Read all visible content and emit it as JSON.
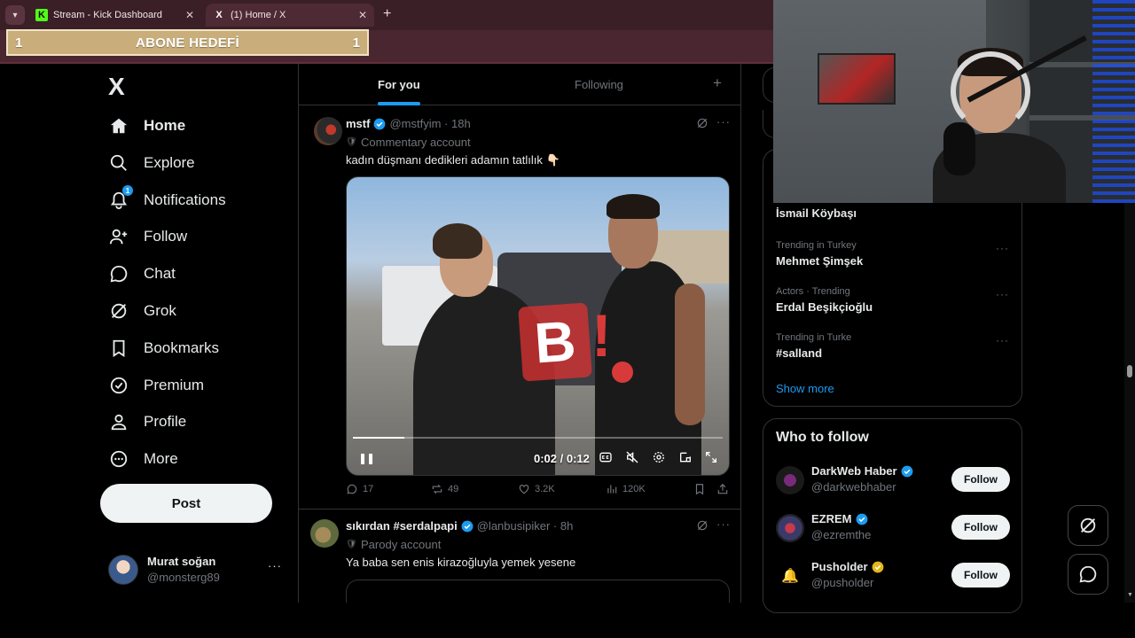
{
  "browser": {
    "tabs": [
      {
        "title": "Stream - Kick Dashboard",
        "favicon": "K",
        "active": false
      },
      {
        "title": "(1) Home / X",
        "favicon": "X",
        "active": true
      }
    ],
    "new_tab_label": "+"
  },
  "overlay": {
    "goal_left": "1",
    "goal_title": "ABONE HEDEFİ",
    "goal_right": "1"
  },
  "nav": {
    "logo": "X",
    "items": [
      {
        "label": "Home",
        "icon": "home-icon"
      },
      {
        "label": "Explore",
        "icon": "search-icon"
      },
      {
        "label": "Notifications",
        "icon": "bell-icon",
        "badge": "1"
      },
      {
        "label": "Follow",
        "icon": "person-add-icon"
      },
      {
        "label": "Chat",
        "icon": "chat-icon"
      },
      {
        "label": "Grok",
        "icon": "grok-icon"
      },
      {
        "label": "Bookmarks",
        "icon": "bookmark-icon"
      },
      {
        "label": "Premium",
        "icon": "premium-icon"
      },
      {
        "label": "Profile",
        "icon": "profile-icon"
      },
      {
        "label": "More",
        "icon": "more-circle-icon"
      }
    ],
    "post_label": "Post",
    "account": {
      "name": "Murat soğan",
      "handle": "@monsterg89",
      "more": "···"
    }
  },
  "feed": {
    "tabs": {
      "for_you": "For you",
      "following": "Following",
      "add": "+"
    },
    "tweets": [
      {
        "name": "mstf",
        "handle": "@mstfyim",
        "time": "18h",
        "account_tag": "Commentary account",
        "text": "kadın düşmanı dedikleri adamın tatlılık 👇🏻",
        "video": {
          "time": "0:02 / 0:12",
          "progress": 0.14
        },
        "stats": {
          "replies": "17",
          "reposts": "49",
          "likes": "3.2K",
          "views": "120K"
        }
      },
      {
        "name": "sıkırdan #serdalpapi",
        "handle": "@lanbusipiker",
        "time": "8h",
        "account_tag": "Parody account",
        "text": "Ya baba sen enis kirazoğluyla yemek yesene"
      }
    ]
  },
  "trends": {
    "items": [
      {
        "category": "",
        "name": "İsmail Köybaşı"
      },
      {
        "category": "Trending in Turkey",
        "name": "Mehmet Şimşek"
      },
      {
        "category": "Actors · Trending",
        "name": "Erdal Beşikçioğlu"
      },
      {
        "category": "Trending in Turke",
        "name": "#salland"
      }
    ],
    "show_more": "Show more"
  },
  "who_to_follow": {
    "title": "Who to follow",
    "accounts": [
      {
        "name": "DarkWeb Haber",
        "handle": "@darkwebhaber",
        "badge_color": "#1d9bf0"
      },
      {
        "name": "EZREM",
        "handle": "@ezremthe",
        "badge_color": "#1d9bf0"
      },
      {
        "name": "Pusholder",
        "handle": "@pusholder",
        "badge_color": "#e2b719"
      }
    ],
    "follow_label": "Follow"
  },
  "colors": {
    "accent": "#1d9bf0",
    "background": "#000000",
    "tab_strip": "#3a1f27"
  }
}
